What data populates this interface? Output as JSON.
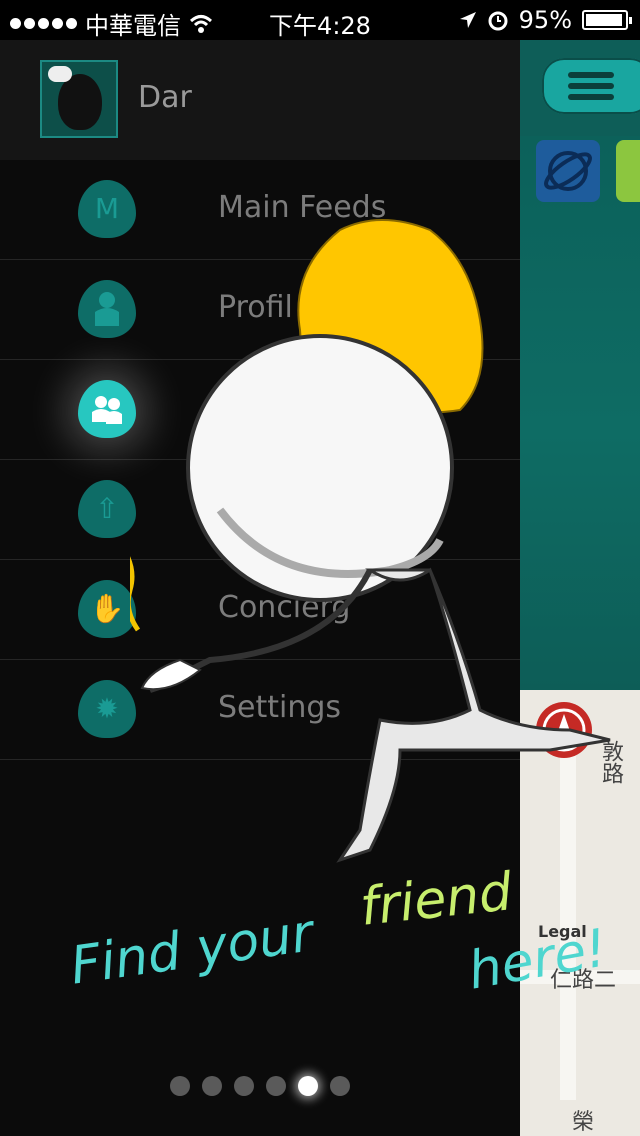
{
  "status_bar": {
    "carrier": "中華電信",
    "time": "下午4:28",
    "battery_text": "95%",
    "battery_level": 0.95
  },
  "profile": {
    "name": "Dar"
  },
  "menu": {
    "items": [
      {
        "label": "Main Feeds",
        "icon": "logo-m-icon"
      },
      {
        "label": "Profil",
        "icon": "person-icon"
      },
      {
        "label": "",
        "icon": "friends-icon",
        "active": true
      },
      {
        "label": "",
        "icon": "upload-icon"
      },
      {
        "label": "Concierg",
        "icon": "hand-icon"
      },
      {
        "label": "Settings",
        "icon": "gear-icon"
      }
    ]
  },
  "overlay": {
    "tagline_part1": "Find your",
    "tagline_part2": "friend",
    "tagline_part3": "here!"
  },
  "map": {
    "legal": "Legal",
    "street1": "敦路",
    "street2": "仁路二",
    "street3": "榮"
  },
  "pager": {
    "count": 6,
    "active_index": 4
  },
  "colors": {
    "accent": "#27c7c0",
    "icon_bg": "#0e6d67",
    "mascot_hair": "#ffc600",
    "tagline_teal": "#4fd6cf",
    "tagline_green": "#c7ee6d"
  }
}
